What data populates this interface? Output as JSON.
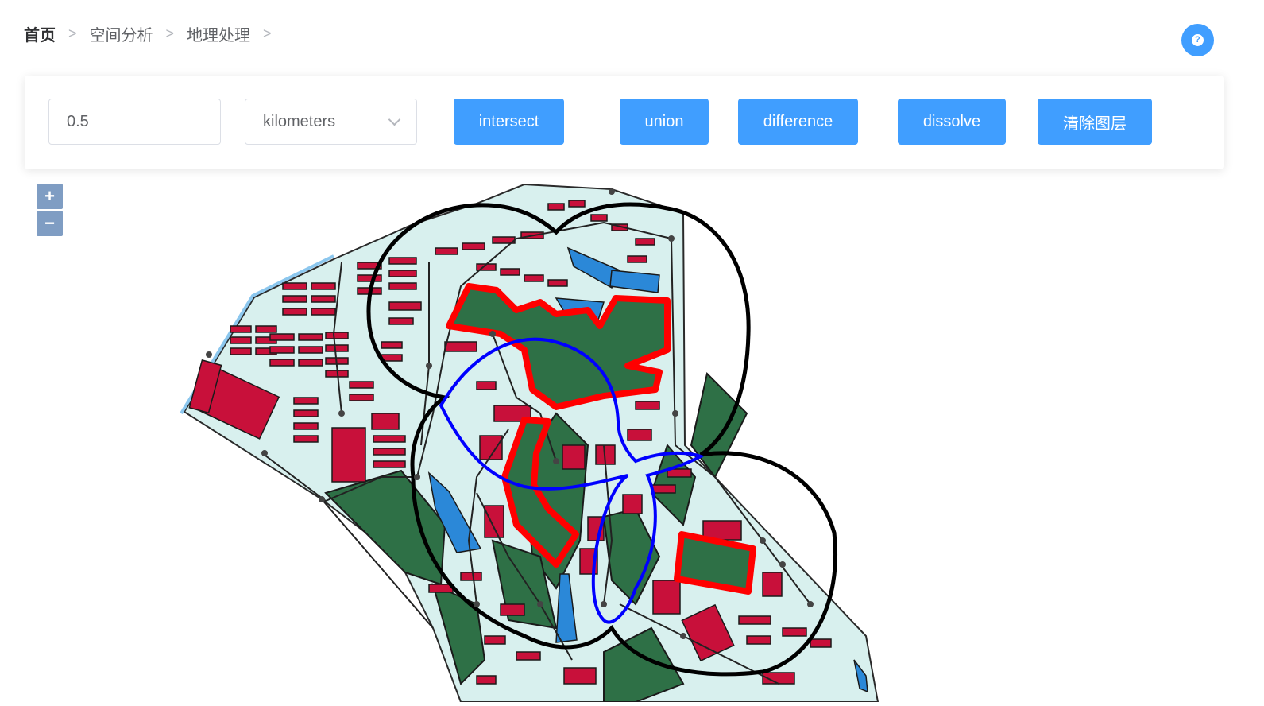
{
  "breadcrumb": {
    "items": [
      "首页",
      "空间分析",
      "地理处理"
    ],
    "separator": ">"
  },
  "help": {
    "glyph": "?",
    "icon": "help-icon"
  },
  "toolbar": {
    "distance_value": "0.5",
    "unit_value": "kilometers",
    "buttons": {
      "intersect": "intersect",
      "union": "union",
      "difference": "difference",
      "dissolve": "dissolve",
      "clear": "清除图层"
    }
  },
  "map": {
    "zoom_in": "+",
    "zoom_out": "−",
    "colors": {
      "campus_fill": "#d8f0ee",
      "building": "#c8103a",
      "green": "#2e7046",
      "water": "#2b88d8",
      "buffer_outline": "#000000",
      "highlight": "#ff0000",
      "overlay": "#0000ff"
    }
  },
  "colors": {
    "accent": "#409eff"
  }
}
